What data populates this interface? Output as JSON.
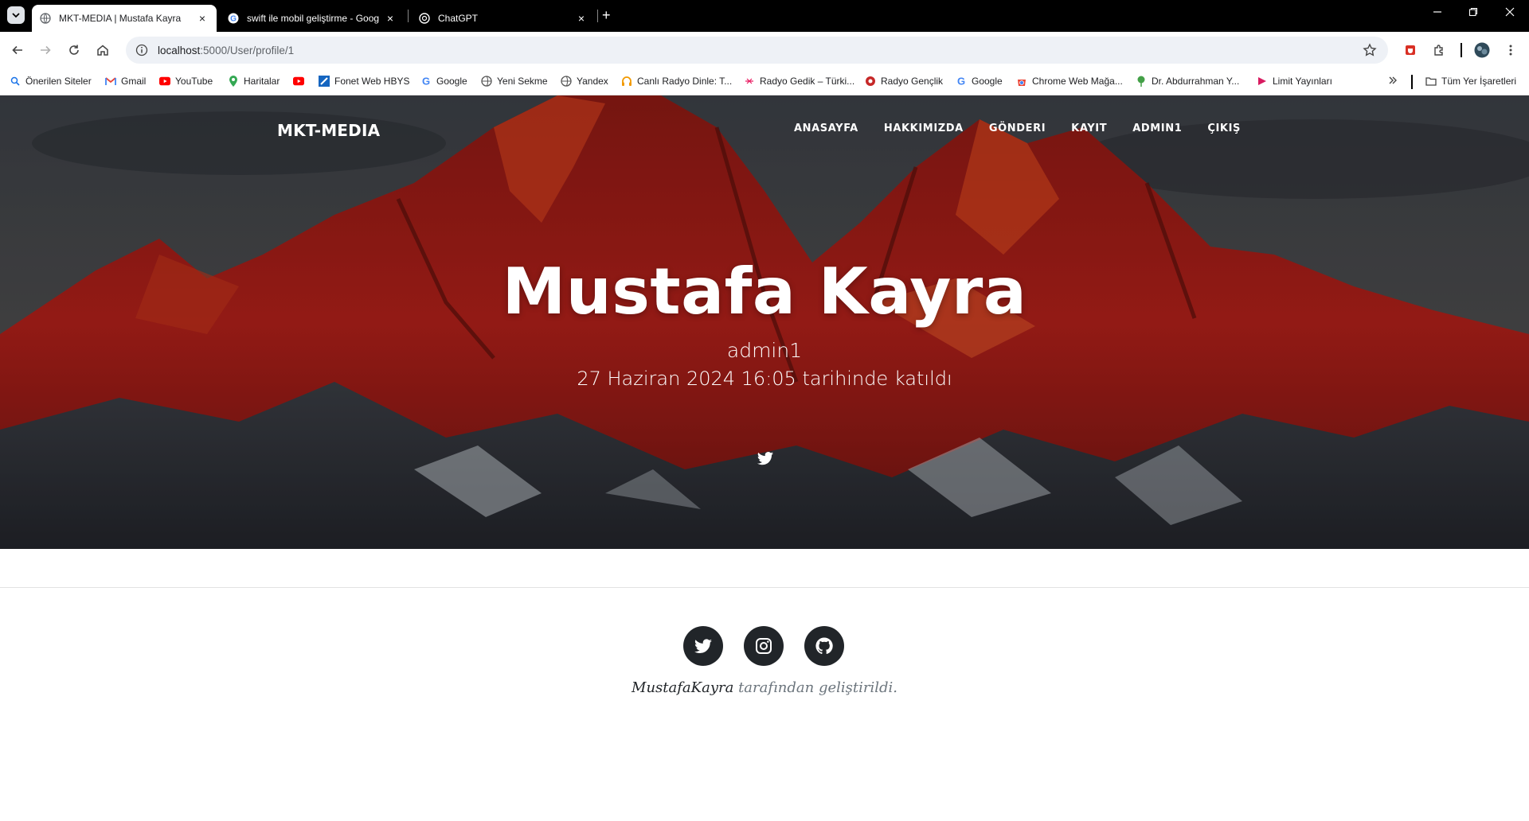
{
  "browser": {
    "tabs": [
      {
        "title": "MKT-MEDIA | Mustafa Kayra",
        "active": true
      },
      {
        "title": "swift ile mobil geliştirme - Goog",
        "active": false
      },
      {
        "title": "ChatGPT",
        "active": false
      }
    ],
    "new_tab_symbol": "+",
    "close_symbol": "×",
    "url": {
      "host": "localhost",
      "path": ":5000/User/profile/1"
    },
    "bookmarks": [
      {
        "label": "Önerilen Siteler",
        "icon": "search-icon"
      },
      {
        "label": "Gmail",
        "icon": "gmail-icon"
      },
      {
        "label": "YouTube",
        "icon": "youtube-icon"
      },
      {
        "label": "Haritalar",
        "icon": "maps-icon"
      },
      {
        "label": "",
        "icon": "youtube-icon"
      },
      {
        "label": "Fonet Web HBYS",
        "icon": "fonet-icon"
      },
      {
        "label": "Google",
        "icon": "google-icon"
      },
      {
        "label": "Yeni Sekme",
        "icon": "globe-icon"
      },
      {
        "label": "Yandex",
        "icon": "globe-icon"
      },
      {
        "label": "Canlı Radyo Dinle: T...",
        "icon": "headphones-icon"
      },
      {
        "label": "Radyo Gedik – Türki...",
        "icon": "radio-icon"
      },
      {
        "label": "Radyo Gençlik",
        "icon": "radio-icon"
      },
      {
        "label": "Google",
        "icon": "google-icon"
      },
      {
        "label": "Chrome Web Mağa...",
        "icon": "webstore-icon"
      },
      {
        "label": "Dr. Abdurrahman Y...",
        "icon": "tree-icon"
      },
      {
        "label": "Limit Yayınları",
        "icon": "limit-icon"
      }
    ],
    "all_bookmarks_label": "Tüm Yer İşaretleri"
  },
  "site": {
    "brand": "MKT-MEDIA",
    "nav": [
      "ANASAYFA",
      "HAKKIMIZDA",
      "GÖNDERI",
      "KAYIT",
      "ADMIN1",
      "ÇIKIŞ"
    ]
  },
  "profile": {
    "name": "Mustafa Kayra",
    "username": "admin1",
    "joined": "27 Haziran 2024 16:05 tarihinde katıldı"
  },
  "footer": {
    "social": [
      "twitter-icon",
      "instagram-icon",
      "github-icon"
    ],
    "author": "MustafaKayra",
    "credit_suffix": "tarafından geliştirildi."
  },
  "colors": {
    "hero_red": "#b3201a",
    "footer_icon_bg": "#212529",
    "credit_text": "#6c757d"
  }
}
